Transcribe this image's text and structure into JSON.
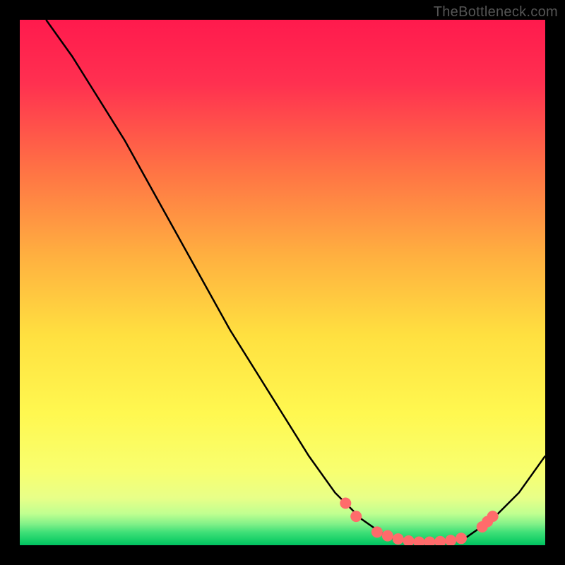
{
  "watermark": "TheBottleneck.com",
  "chart_data": {
    "type": "line",
    "title": "",
    "xlabel": "",
    "ylabel": "",
    "xlim": [
      0,
      100
    ],
    "ylim": [
      0,
      100
    ],
    "background_gradient": {
      "top": "#ff1a4d",
      "upper_mid": "#ff8040",
      "mid": "#ffd940",
      "lower_mid": "#f5ff60",
      "green_band_top": "#d0ff80",
      "green_band": "#20e070",
      "bottom": "#00c060"
    },
    "curve": [
      {
        "x": 5,
        "y": 100
      },
      {
        "x": 10,
        "y": 93
      },
      {
        "x": 15,
        "y": 85
      },
      {
        "x": 20,
        "y": 77
      },
      {
        "x": 25,
        "y": 68
      },
      {
        "x": 30,
        "y": 59
      },
      {
        "x": 35,
        "y": 50
      },
      {
        "x": 40,
        "y": 41
      },
      {
        "x": 45,
        "y": 33
      },
      {
        "x": 50,
        "y": 25
      },
      {
        "x": 55,
        "y": 17
      },
      {
        "x": 60,
        "y": 10
      },
      {
        "x": 65,
        "y": 5
      },
      {
        "x": 70,
        "y": 1.5
      },
      {
        "x": 75,
        "y": 0.5
      },
      {
        "x": 80,
        "y": 0.5
      },
      {
        "x": 85,
        "y": 1.5
      },
      {
        "x": 90,
        "y": 5
      },
      {
        "x": 95,
        "y": 10
      },
      {
        "x": 100,
        "y": 17
      }
    ],
    "markers": [
      {
        "x": 62,
        "y": 8
      },
      {
        "x": 64,
        "y": 5.5
      },
      {
        "x": 68,
        "y": 2.5
      },
      {
        "x": 70,
        "y": 1.8
      },
      {
        "x": 72,
        "y": 1.2
      },
      {
        "x": 74,
        "y": 0.8
      },
      {
        "x": 76,
        "y": 0.6
      },
      {
        "x": 78,
        "y": 0.6
      },
      {
        "x": 80,
        "y": 0.7
      },
      {
        "x": 82,
        "y": 0.9
      },
      {
        "x": 84,
        "y": 1.3
      },
      {
        "x": 88,
        "y": 3.5
      },
      {
        "x": 89,
        "y": 4.5
      },
      {
        "x": 90,
        "y": 5.5
      }
    ],
    "marker_color": "#ff6b6b",
    "curve_color": "#000000"
  }
}
